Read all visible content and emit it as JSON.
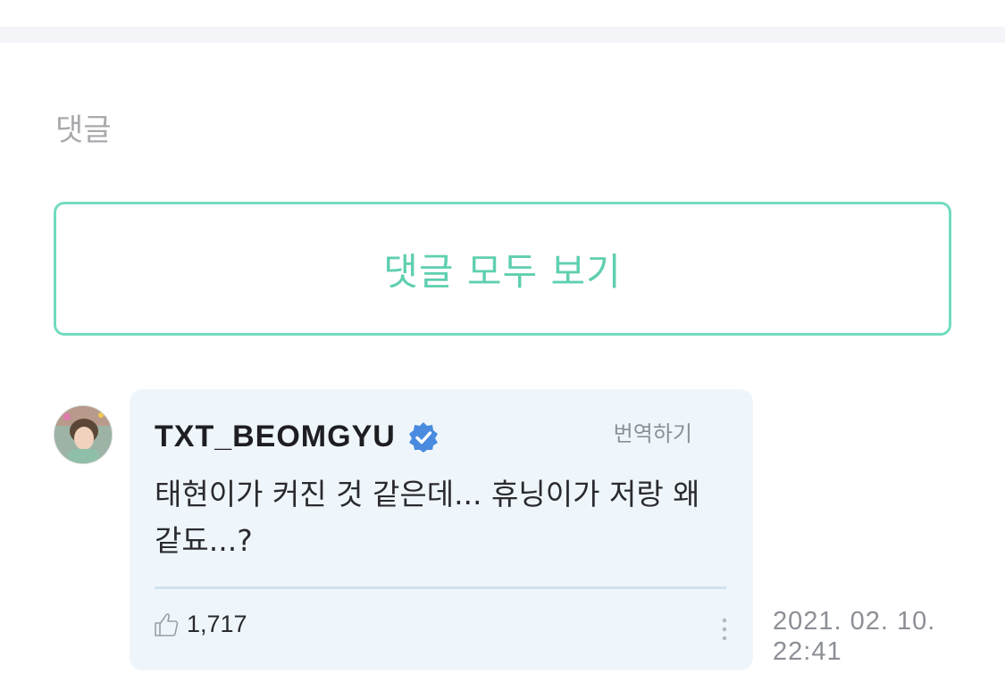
{
  "comments_section": {
    "title": "댓글",
    "view_all_label": "댓글 모두 보기"
  },
  "comment": {
    "author": "TXT_BEOMGYU",
    "verified": true,
    "translate_label": "번역하기",
    "text": "태현이가 커진 것 같은데... 휴닝이가 저랑 왜 같됴...?",
    "likes": "1,717",
    "date": "2021. 02. 10.",
    "time": "22:41"
  },
  "colors": {
    "accent": "#72dbc0",
    "bubble_bg": "#eff6fb",
    "verified_badge": "#4a8be0",
    "muted_text": "#8c8f96"
  },
  "icons": {
    "verified": "verified-badge-icon",
    "like": "thumbs-up-icon",
    "more": "more-vertical-icon"
  }
}
